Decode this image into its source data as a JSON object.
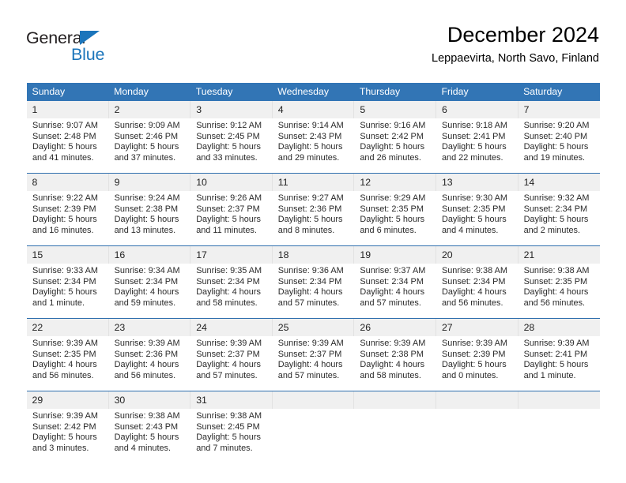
{
  "logo": {
    "word_top": "General",
    "word_bottom": "Blue",
    "triangle_color": "#1b75bb",
    "text_color": "#231f20"
  },
  "header": {
    "title": "December 2024",
    "subtitle": "Leppaevirta, North Savo, Finland"
  },
  "colors": {
    "header_blue": "#3275b5",
    "daynum_gray": "#f0f0f0",
    "week_separator": "#2f6fae"
  },
  "weekdays": [
    "Sunday",
    "Monday",
    "Tuesday",
    "Wednesday",
    "Thursday",
    "Friday",
    "Saturday"
  ],
  "weeks": [
    [
      {
        "day": "1",
        "sunrise": "Sunrise: 9:07 AM",
        "sunset": "Sunset: 2:48 PM",
        "daylight1": "Daylight: 5 hours",
        "daylight2": "and 41 minutes."
      },
      {
        "day": "2",
        "sunrise": "Sunrise: 9:09 AM",
        "sunset": "Sunset: 2:46 PM",
        "daylight1": "Daylight: 5 hours",
        "daylight2": "and 37 minutes."
      },
      {
        "day": "3",
        "sunrise": "Sunrise: 9:12 AM",
        "sunset": "Sunset: 2:45 PM",
        "daylight1": "Daylight: 5 hours",
        "daylight2": "and 33 minutes."
      },
      {
        "day": "4",
        "sunrise": "Sunrise: 9:14 AM",
        "sunset": "Sunset: 2:43 PM",
        "daylight1": "Daylight: 5 hours",
        "daylight2": "and 29 minutes."
      },
      {
        "day": "5",
        "sunrise": "Sunrise: 9:16 AM",
        "sunset": "Sunset: 2:42 PM",
        "daylight1": "Daylight: 5 hours",
        "daylight2": "and 26 minutes."
      },
      {
        "day": "6",
        "sunrise": "Sunrise: 9:18 AM",
        "sunset": "Sunset: 2:41 PM",
        "daylight1": "Daylight: 5 hours",
        "daylight2": "and 22 minutes."
      },
      {
        "day": "7",
        "sunrise": "Sunrise: 9:20 AM",
        "sunset": "Sunset: 2:40 PM",
        "daylight1": "Daylight: 5 hours",
        "daylight2": "and 19 minutes."
      }
    ],
    [
      {
        "day": "8",
        "sunrise": "Sunrise: 9:22 AM",
        "sunset": "Sunset: 2:39 PM",
        "daylight1": "Daylight: 5 hours",
        "daylight2": "and 16 minutes."
      },
      {
        "day": "9",
        "sunrise": "Sunrise: 9:24 AM",
        "sunset": "Sunset: 2:38 PM",
        "daylight1": "Daylight: 5 hours",
        "daylight2": "and 13 minutes."
      },
      {
        "day": "10",
        "sunrise": "Sunrise: 9:26 AM",
        "sunset": "Sunset: 2:37 PM",
        "daylight1": "Daylight: 5 hours",
        "daylight2": "and 11 minutes."
      },
      {
        "day": "11",
        "sunrise": "Sunrise: 9:27 AM",
        "sunset": "Sunset: 2:36 PM",
        "daylight1": "Daylight: 5 hours",
        "daylight2": "and 8 minutes."
      },
      {
        "day": "12",
        "sunrise": "Sunrise: 9:29 AM",
        "sunset": "Sunset: 2:35 PM",
        "daylight1": "Daylight: 5 hours",
        "daylight2": "and 6 minutes."
      },
      {
        "day": "13",
        "sunrise": "Sunrise: 9:30 AM",
        "sunset": "Sunset: 2:35 PM",
        "daylight1": "Daylight: 5 hours",
        "daylight2": "and 4 minutes."
      },
      {
        "day": "14",
        "sunrise": "Sunrise: 9:32 AM",
        "sunset": "Sunset: 2:34 PM",
        "daylight1": "Daylight: 5 hours",
        "daylight2": "and 2 minutes."
      }
    ],
    [
      {
        "day": "15",
        "sunrise": "Sunrise: 9:33 AM",
        "sunset": "Sunset: 2:34 PM",
        "daylight1": "Daylight: 5 hours",
        "daylight2": "and 1 minute."
      },
      {
        "day": "16",
        "sunrise": "Sunrise: 9:34 AM",
        "sunset": "Sunset: 2:34 PM",
        "daylight1": "Daylight: 4 hours",
        "daylight2": "and 59 minutes."
      },
      {
        "day": "17",
        "sunrise": "Sunrise: 9:35 AM",
        "sunset": "Sunset: 2:34 PM",
        "daylight1": "Daylight: 4 hours",
        "daylight2": "and 58 minutes."
      },
      {
        "day": "18",
        "sunrise": "Sunrise: 9:36 AM",
        "sunset": "Sunset: 2:34 PM",
        "daylight1": "Daylight: 4 hours",
        "daylight2": "and 57 minutes."
      },
      {
        "day": "19",
        "sunrise": "Sunrise: 9:37 AM",
        "sunset": "Sunset: 2:34 PM",
        "daylight1": "Daylight: 4 hours",
        "daylight2": "and 57 minutes."
      },
      {
        "day": "20",
        "sunrise": "Sunrise: 9:38 AM",
        "sunset": "Sunset: 2:34 PM",
        "daylight1": "Daylight: 4 hours",
        "daylight2": "and 56 minutes."
      },
      {
        "day": "21",
        "sunrise": "Sunrise: 9:38 AM",
        "sunset": "Sunset: 2:35 PM",
        "daylight1": "Daylight: 4 hours",
        "daylight2": "and 56 minutes."
      }
    ],
    [
      {
        "day": "22",
        "sunrise": "Sunrise: 9:39 AM",
        "sunset": "Sunset: 2:35 PM",
        "daylight1": "Daylight: 4 hours",
        "daylight2": "and 56 minutes."
      },
      {
        "day": "23",
        "sunrise": "Sunrise: 9:39 AM",
        "sunset": "Sunset: 2:36 PM",
        "daylight1": "Daylight: 4 hours",
        "daylight2": "and 56 minutes."
      },
      {
        "day": "24",
        "sunrise": "Sunrise: 9:39 AM",
        "sunset": "Sunset: 2:37 PM",
        "daylight1": "Daylight: 4 hours",
        "daylight2": "and 57 minutes."
      },
      {
        "day": "25",
        "sunrise": "Sunrise: 9:39 AM",
        "sunset": "Sunset: 2:37 PM",
        "daylight1": "Daylight: 4 hours",
        "daylight2": "and 57 minutes."
      },
      {
        "day": "26",
        "sunrise": "Sunrise: 9:39 AM",
        "sunset": "Sunset: 2:38 PM",
        "daylight1": "Daylight: 4 hours",
        "daylight2": "and 58 minutes."
      },
      {
        "day": "27",
        "sunrise": "Sunrise: 9:39 AM",
        "sunset": "Sunset: 2:39 PM",
        "daylight1": "Daylight: 5 hours",
        "daylight2": "and 0 minutes."
      },
      {
        "day": "28",
        "sunrise": "Sunrise: 9:39 AM",
        "sunset": "Sunset: 2:41 PM",
        "daylight1": "Daylight: 5 hours",
        "daylight2": "and 1 minute."
      }
    ],
    [
      {
        "day": "29",
        "sunrise": "Sunrise: 9:39 AM",
        "sunset": "Sunset: 2:42 PM",
        "daylight1": "Daylight: 5 hours",
        "daylight2": "and 3 minutes."
      },
      {
        "day": "30",
        "sunrise": "Sunrise: 9:38 AM",
        "sunset": "Sunset: 2:43 PM",
        "daylight1": "Daylight: 5 hours",
        "daylight2": "and 4 minutes."
      },
      {
        "day": "31",
        "sunrise": "Sunrise: 9:38 AM",
        "sunset": "Sunset: 2:45 PM",
        "daylight1": "Daylight: 5 hours",
        "daylight2": "and 7 minutes."
      },
      {
        "day": "",
        "sunrise": "",
        "sunset": "",
        "daylight1": "",
        "daylight2": ""
      },
      {
        "day": "",
        "sunrise": "",
        "sunset": "",
        "daylight1": "",
        "daylight2": ""
      },
      {
        "day": "",
        "sunrise": "",
        "sunset": "",
        "daylight1": "",
        "daylight2": ""
      },
      {
        "day": "",
        "sunrise": "",
        "sunset": "",
        "daylight1": "",
        "daylight2": ""
      }
    ]
  ]
}
